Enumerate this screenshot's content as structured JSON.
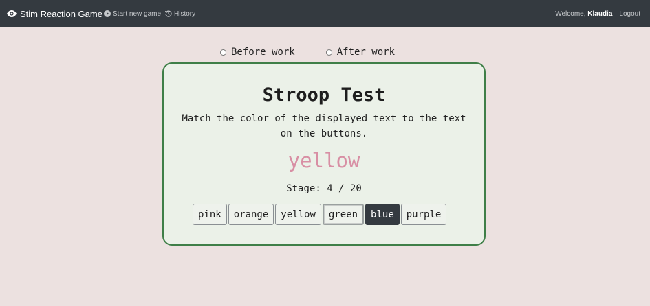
{
  "navbar": {
    "brand": "Stim Reaction Game",
    "start_new_game": "Start new game",
    "history": "History",
    "welcome_prefix": "Welcome,",
    "username": "Klaudia",
    "logout": "Logout"
  },
  "radios": [
    {
      "label": "Before work",
      "checked": false
    },
    {
      "label": "After work",
      "checked": false
    }
  ],
  "card": {
    "title": "Stroop Test",
    "instructions": "Match the color of the displayed text to the text on the buttons.",
    "word": "yellow",
    "word_color": "#d88fa4",
    "stage_label": "Stage: 4 / 20"
  },
  "color_buttons": [
    "pink",
    "orange",
    "yellow",
    "green",
    "blue",
    "purple"
  ],
  "colors": {
    "navbar_bg": "#343a40",
    "page_bg": "#ece1e0",
    "card_bg": "#ebf1e8",
    "card_border": "#3f7f48"
  }
}
